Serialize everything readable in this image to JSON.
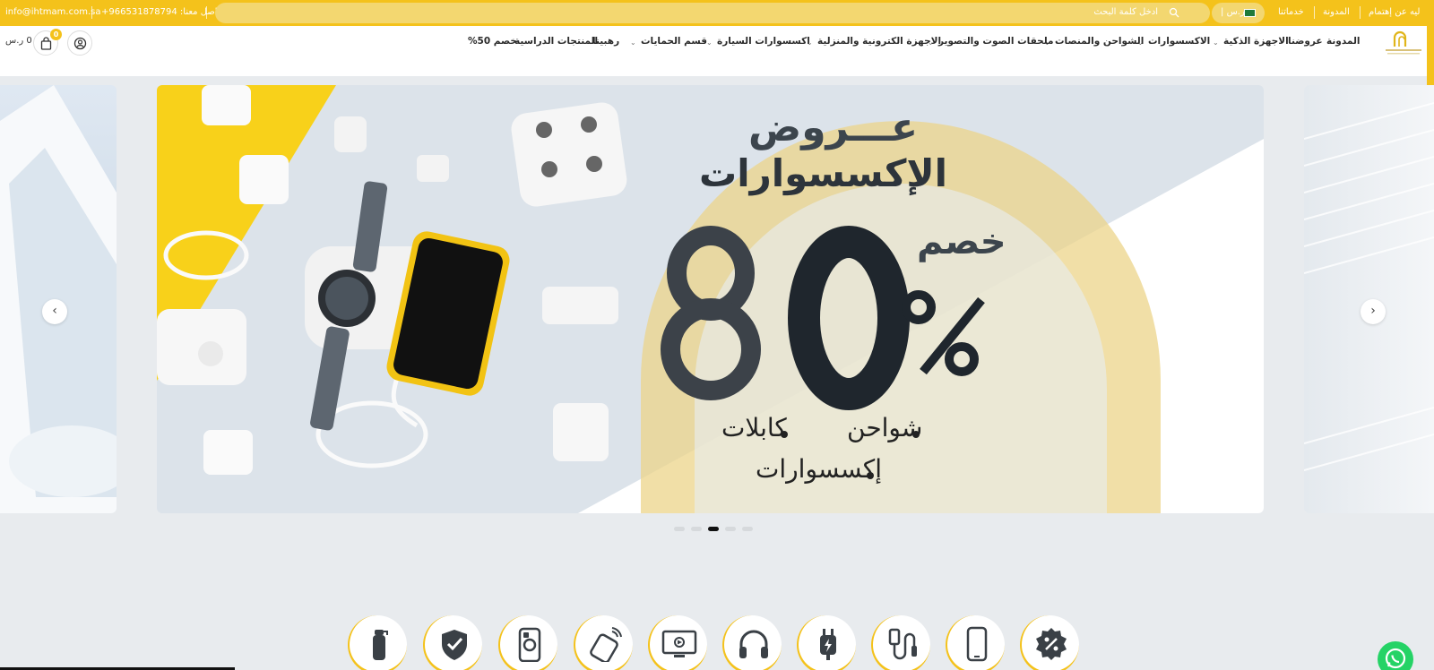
{
  "topbar": {
    "email": "info@ihtmam.com.sa",
    "phone": "تواصل معنا: 966531878794+",
    "search_placeholder": "ادخل كلمة البحث",
    "currency_label": "| ر.س",
    "links": [
      "ليه عن إهتمام",
      "المدونة",
      "خدماتنا"
    ]
  },
  "header": {
    "nav": {
      "blog": "المدونة",
      "offers": "عروضنا",
      "smart_devices": "الاجهزة الذكية",
      "accessories": "الاكسسوارات",
      "chargers": "الشواحن والمنصات",
      "audio": "ملحقات الصوت والتصوير",
      "electronics": "الاجهزة الكترونية والمنزلية",
      "car": "اكسسوارات السيارة",
      "protection": "قسم الحمايات",
      "rahbina": "رهبينا",
      "study": "المنتجات الدراسية",
      "discount": "خصم 50%"
    },
    "cart_count": "0",
    "cart_total": "0 ر.س"
  },
  "slider": {
    "title": "عـــروض",
    "subtitle": "الإكسسوارات",
    "discount_word": "خصم",
    "discount_value": "80%",
    "bullets": [
      "شواحن",
      "كابلات",
      "إكسسوارات"
    ],
    "active_index": 2,
    "dot_count": 5,
    "prev_icon": "chevron-left-icon",
    "next_icon": "chevron-right-icon"
  },
  "categories": [
    {
      "icon": "bottle-icon"
    },
    {
      "icon": "shield-check-icon"
    },
    {
      "icon": "phone-case-icon"
    },
    {
      "icon": "remote-icon"
    },
    {
      "icon": "tv-icon"
    },
    {
      "icon": "headphones-icon"
    },
    {
      "icon": "charger-plug-icon"
    },
    {
      "icon": "usb-cable-icon"
    },
    {
      "icon": "smartphone-icon"
    },
    {
      "icon": "discount-badge-icon"
    }
  ],
  "colors": {
    "accent": "#f4c21b",
    "background": "#e8ebee",
    "whatsapp": "#25d366"
  }
}
